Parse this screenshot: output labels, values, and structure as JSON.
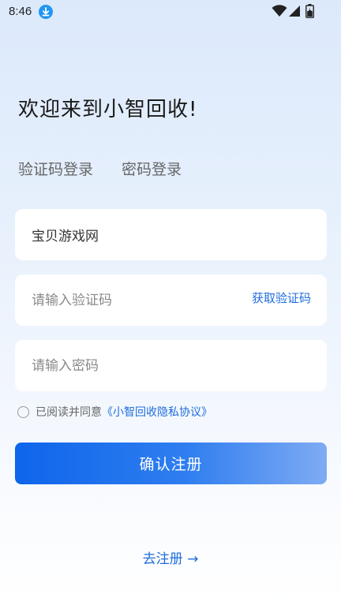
{
  "status_bar": {
    "time": "8:46",
    "icons": [
      "download-icon",
      "wifi-icon",
      "signal-icon",
      "battery-icon"
    ]
  },
  "welcome": "欢迎来到小智回收!",
  "tabs": {
    "sms": "验证码登录",
    "password": "密码登录"
  },
  "form": {
    "phone_value": "宝贝游戏网",
    "code_placeholder": "请输入验证码",
    "get_code_label": "获取验证码",
    "password_placeholder": "请输入密码"
  },
  "agreement": {
    "text": "已阅读并同意",
    "link": "《小智回收隐私协议》"
  },
  "confirm_button": "确认注册",
  "register_link": "去注册 →",
  "colors": {
    "accent": "#1e6ddc",
    "button_start": "#0f65ea",
    "button_end": "#7fabf3"
  }
}
